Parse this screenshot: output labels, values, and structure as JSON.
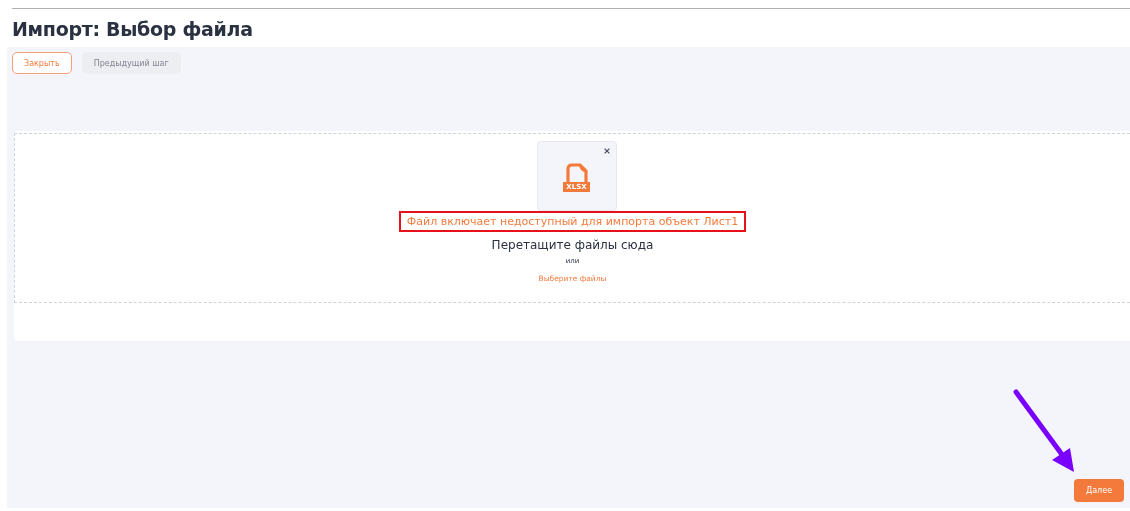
{
  "title": "Импорт: Выбор файла",
  "toolbar": [
    {
      "label": "Закрыть",
      "disabled": false
    },
    {
      "label": "Предыдущий шаг",
      "disabled": true
    }
  ],
  "file": {
    "type_label": "XLSX"
  },
  "error": {
    "text": "Файл включает недоступный для импорта объект Лист1",
    "highlighted": true
  },
  "dropzone": {
    "hint": "Перетащите файлы сюда",
    "or": "или",
    "link": "Выберите файлы"
  },
  "next_button": {
    "label": "Далее"
  },
  "annotation_arrow": true
}
